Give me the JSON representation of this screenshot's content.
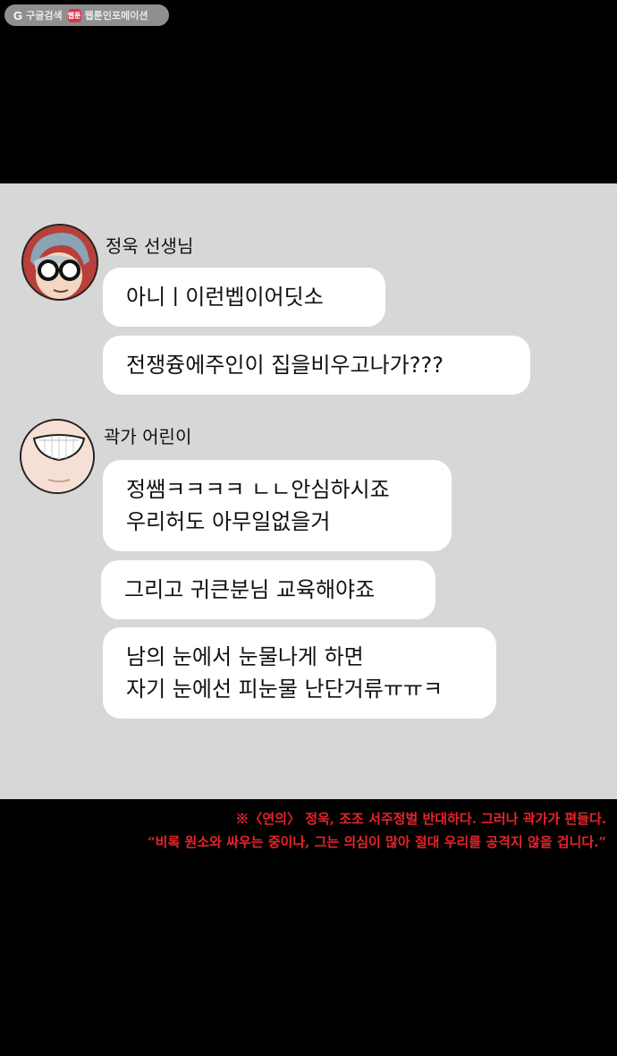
{
  "badge": {
    "google_mark": "G",
    "google_label": "구글검색",
    "webtoon_mark": "웹툰",
    "webtoon_label": "웹툰인포메이션"
  },
  "chat": {
    "background": "#d7d7d7",
    "groups": [
      {
        "sender": "정욱 선생님",
        "messages": [
          {
            "lines": [
              "아니ㅣ이런벱이어딧소"
            ]
          },
          {
            "lines": [
              "전쟁즁에주인이 집을비우고나가???"
            ]
          }
        ]
      },
      {
        "sender": "곽가 어린이",
        "messages": [
          {
            "lines": [
              "정쌤ㅋㅋㅋㅋ ㄴㄴ안심하시죠",
              "우리허도 아무일없을거"
            ]
          },
          {
            "lines": [
              "그리고 귀큰분님 교육해야죠"
            ]
          },
          {
            "lines": [
              "남의 눈에서 눈물나게 하면",
              "자기 눈에선 피눈물 난단거류ㅠㅠㅋ"
            ]
          }
        ]
      }
    ]
  },
  "footnote": {
    "color": "#e8232a",
    "line1": "※〈연의〉 정욱, 조조 서주정벌 반대하다. 그러나 곽가가 편들다.",
    "line2": "“비록 원소와 싸우는 중이나, 그는 의심이 많아 절대 우리를 공격지 않을 겁니다.”"
  }
}
